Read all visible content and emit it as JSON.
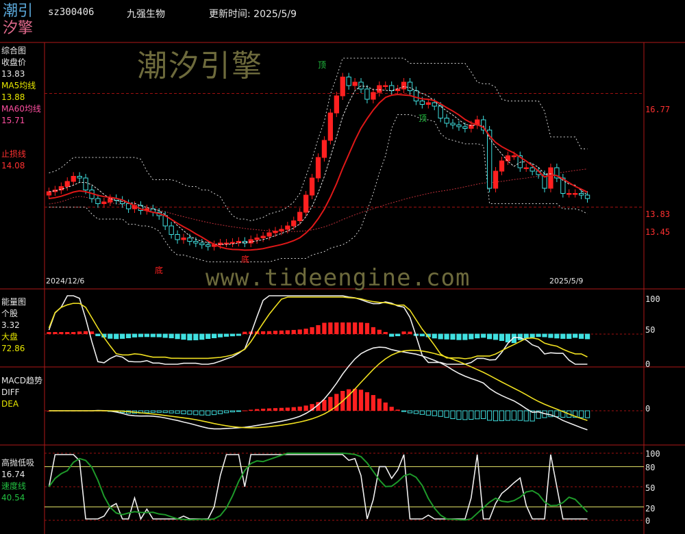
{
  "header": {
    "logo_line1": "潮引",
    "logo_line2": "汐擎",
    "code": "sz300406",
    "name": "九强生物",
    "update": "更新时间: 2025/5/9"
  },
  "watermark_top": "潮汐引擎",
  "watermark_url": "www.tideengine.com",
  "panels": {
    "main": {
      "title": "综合图",
      "items": [
        {
          "label": "收盘价",
          "value": "13.83",
          "color": "#e8e8e8"
        },
        {
          "label": "MA5均线",
          "value": "13.88",
          "color": "#e8e800"
        },
        {
          "label": "MA60均线",
          "value": "15.71",
          "color": "#ff4fa0"
        }
      ],
      "stop_label": "止损线",
      "stop_value": "14.08",
      "right_labels": [
        "16.77",
        "13.83",
        "13.45"
      ],
      "date_start": "2024/12/6",
      "date_end": "2025/5/9",
      "ann_top1": "顶",
      "ann_top2": "顶",
      "ann_bottom1": "底",
      "ann_bottom2": "底"
    },
    "energy": {
      "title": "能量图",
      "l1": "个股",
      "v1": "3.32",
      "l2": "大盘",
      "v2": "72.86",
      "axis": [
        "100",
        "50",
        "0"
      ]
    },
    "macd": {
      "title": "MACD趋势",
      "l1": "DIFF",
      "l2": "DEA",
      "axis": [
        "0"
      ]
    },
    "osc": {
      "title": "高抛低吸",
      "v1": "16.74",
      "l2": "速度线",
      "v2": "40.54",
      "axis": [
        "100",
        "80",
        "50",
        "20",
        "0"
      ]
    }
  },
  "colors": {
    "up": "#ff2020",
    "down": "#40e0e0",
    "ma": "#e01818",
    "grid": "#a01010"
  },
  "chart_data": [
    {
      "type": "candlestick",
      "title": "综合图",
      "x_range": [
        "2024/12/6",
        "2025/5/9"
      ],
      "y_ticks": [
        16.77,
        13.83,
        13.45
      ],
      "closes": [
        13.9,
        13.95,
        14.05,
        14.2,
        14.35,
        14.3,
        13.95,
        13.7,
        13.55,
        13.6,
        13.7,
        13.65,
        13.55,
        13.4,
        13.5,
        13.35,
        13.4,
        13.3,
        13.2,
        12.9,
        12.65,
        12.5,
        12.55,
        12.45,
        12.4,
        12.35,
        12.3,
        12.35,
        12.4,
        12.4,
        12.42,
        12.45,
        12.4,
        12.5,
        12.55,
        12.6,
        12.7,
        12.75,
        12.8,
        12.9,
        13.05,
        13.3,
        13.8,
        14.3,
        14.9,
        15.4,
        16.2,
        16.7,
        17.25,
        17.0,
        17.1,
        16.9,
        16.6,
        16.8,
        17.0,
        17.0,
        16.85,
        16.9,
        17.1,
        16.85,
        16.55,
        16.45,
        16.5,
        16.4,
        16.05,
        15.9,
        15.85,
        15.8,
        15.75,
        15.85,
        16.0,
        15.7,
        14.0,
        14.5,
        14.8,
        14.95,
        14.95,
        14.6,
        14.6,
        14.5,
        14.4,
        14.0,
        14.6,
        14.3,
        13.85,
        13.85,
        13.85,
        13.8,
        13.7
      ]
    },
    {
      "type": "bar+line",
      "title": "能量图",
      "ylim": [
        0,
        100
      ],
      "series": [
        {
          "name": "个股",
          "value_last": 3.32
        },
        {
          "name": "大盘",
          "value_last": 72.86
        }
      ]
    },
    {
      "type": "bar+line",
      "title": "MACD趋势",
      "series": [
        {
          "name": "DIFF"
        },
        {
          "name": "DEA"
        }
      ]
    },
    {
      "type": "line",
      "title": "高抛低吸",
      "ylim": [
        0,
        100
      ],
      "y_ticks": [
        100,
        80,
        50,
        20,
        0
      ],
      "series": [
        {
          "name": "高抛低吸",
          "value_last": 16.74
        },
        {
          "name": "速度线",
          "value_last": 40.54
        }
      ]
    }
  ]
}
